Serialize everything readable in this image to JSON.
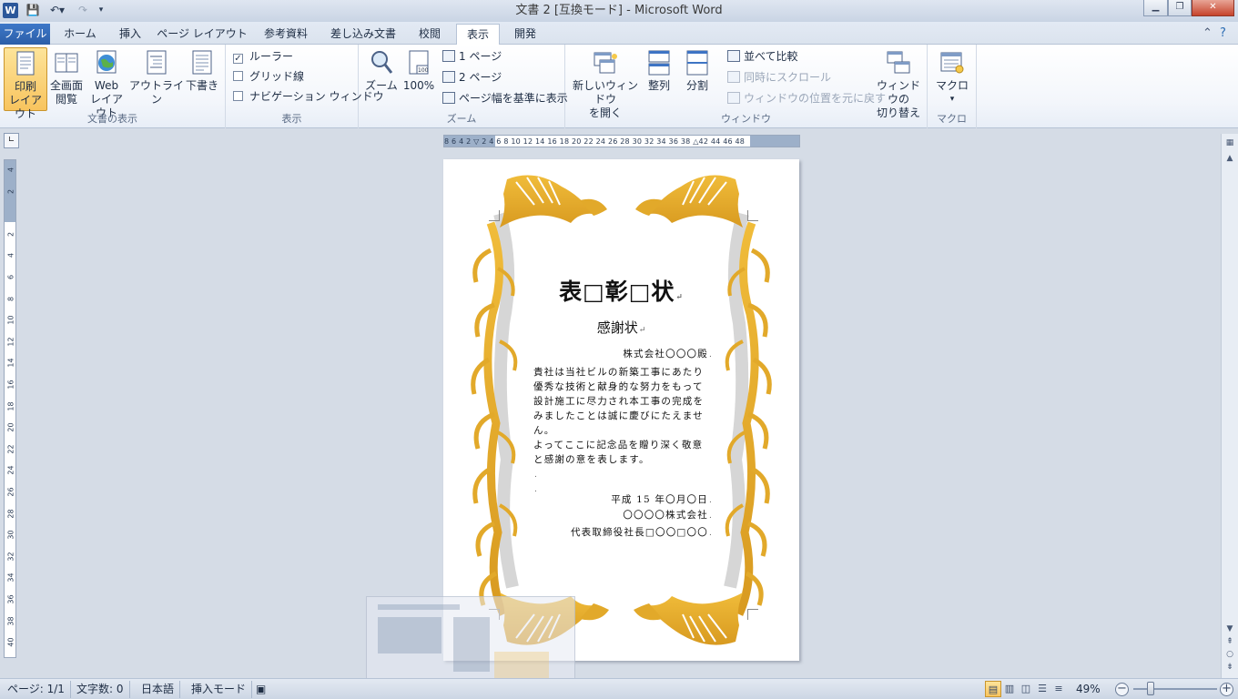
{
  "window": {
    "title": "文書 2 [互換モード] - Microsoft Word",
    "app_icon": "W",
    "controls": [
      "minimize",
      "restore",
      "close"
    ]
  },
  "tabs": [
    {
      "label": "ファイル"
    },
    {
      "label": "ホーム"
    },
    {
      "label": "挿入"
    },
    {
      "label": "ページ レイアウト"
    },
    {
      "label": "参考資料"
    },
    {
      "label": "差し込み文書"
    },
    {
      "label": "校閲"
    },
    {
      "label": "表示"
    },
    {
      "label": "開発"
    }
  ],
  "active_tab": "表示",
  "ribbon": {
    "groups": {
      "views": {
        "label": "文書の表示",
        "print_layout": "印刷\nレイアウト",
        "full_screen": "全画面\n閲覧",
        "web_layout": "Web\nレイアウト",
        "outline": "アウトライン",
        "draft": "下書き"
      },
      "show": {
        "label": "表示",
        "ruler": "ルーラー",
        "ruler_checked": true,
        "gridlines": "グリッド線",
        "gridlines_checked": false,
        "navigation": "ナビゲーション ウィンドウ",
        "navigation_checked": false
      },
      "zoom": {
        "label": "ズーム",
        "zoom_button": "ズーム",
        "hundred": "100%",
        "one_page": "1 ページ",
        "two_pages": "2 ページ",
        "page_width": "ページ幅を基準に表示"
      },
      "window": {
        "label": "ウィンドウ",
        "new_window": "新しいウィンドウ\nを開く",
        "arrange": "整列",
        "split": "分割",
        "side_by_side": "並べて比較",
        "sync_scroll": "同時にスクロール",
        "reset_position": "ウィンドウの位置を元に戻す",
        "switch_windows": "ウィンドウの\n切り替え"
      },
      "macros": {
        "label": "マクロ",
        "macros_button": "マクロ"
      }
    }
  },
  "ruler": {
    "horizontal_ticks": "8 6 4 2 ▽ 2 4 6 8 10 12 14 16 18 20 22 24 26 28 30 32 34 36 38 △42 44 46 48",
    "vertical_ticks": [
      "4",
      "2",
      "",
      "2",
      "4",
      "6",
      "8",
      "10",
      "12",
      "14",
      "16",
      "18",
      "20",
      "22",
      "24",
      "26",
      "28",
      "30",
      "32",
      "34",
      "36",
      "38",
      "40"
    ]
  },
  "document": {
    "title": "表□彰□状",
    "subtitle": "感謝状",
    "addressee": "株式会社〇〇〇殿",
    "body_lines": [
      "貴社は当社ビルの新築工事にあたり",
      "優秀な技術と献身的な努力をもって",
      "設計施工に尽力され本工事の完成を",
      "みましたことは誠に慶びにたえませ",
      "ん。",
      "よってここに記念品を贈り深く敬意",
      "と感謝の意を表します。",
      "",
      ""
    ],
    "date": "平成 15 年〇月〇日",
    "company": "〇〇〇〇株式会社",
    "signatory": "代表取締役社長□〇〇□〇〇",
    "paragraph_mark": "↵",
    "line_mark": "."
  },
  "statusbar": {
    "page": "ページ: 1/1",
    "word_count": "文字数: 0",
    "language": "日本語",
    "mode": "挿入モード",
    "zoom": "49%"
  },
  "colors": {
    "accent": "#2b579a",
    "file_tab": "#2c5ea8",
    "gold": "#e2a92a",
    "pressed": "#f8c45e"
  }
}
